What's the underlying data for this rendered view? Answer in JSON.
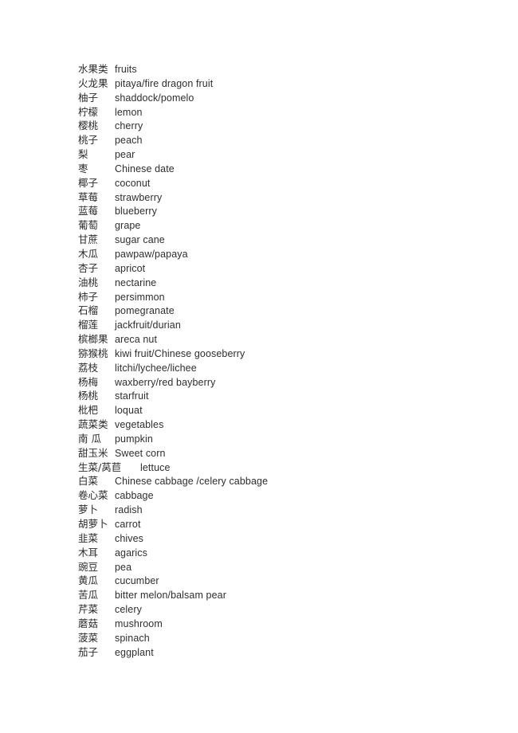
{
  "document": {
    "background_color": "#ffffff",
    "text_color": "#2e2e2e",
    "entries": [
      {
        "term": "水果类",
        "gloss": "fruits"
      },
      {
        "term": "火龙果",
        "gloss": "pitaya/fire dragon fruit"
      },
      {
        "term": "柚子",
        "gloss": "shaddock/pomelo"
      },
      {
        "term": "柠檬",
        "gloss": "lemon"
      },
      {
        "term": "樱桃",
        "gloss": "cherry"
      },
      {
        "term": "桃子",
        "gloss": "peach"
      },
      {
        "term": "梨",
        "gloss": "pear"
      },
      {
        "term": "枣",
        "gloss": "Chinese date"
      },
      {
        "term": "椰子",
        "gloss": "coconut"
      },
      {
        "term": "草莓",
        "gloss": "strawberry"
      },
      {
        "term": "蓝莓",
        "gloss": "blueberry"
      },
      {
        "term": "葡萄",
        "gloss": "grape"
      },
      {
        "term": "甘蔗",
        "gloss": "sugar cane"
      },
      {
        "term": "木瓜",
        "gloss": "pawpaw/papaya"
      },
      {
        "term": "杏子",
        "gloss": "apricot"
      },
      {
        "term": "油桃",
        "gloss": "nectarine"
      },
      {
        "term": "柿子",
        "gloss": "persimmon"
      },
      {
        "term": "石榴",
        "gloss": "pomegranate"
      },
      {
        "term": "榴莲",
        "gloss": "jackfruit/durian"
      },
      {
        "term": "槟榔果",
        "gloss": "areca nut"
      },
      {
        "term": "猕猴桃",
        "gloss": "kiwi fruit/Chinese gooseberry"
      },
      {
        "term": "荔枝",
        "gloss": "litchi/lychee/lichee"
      },
      {
        "term": "杨梅",
        "gloss": "waxberry/red bayberry"
      },
      {
        "term": "杨桃",
        "gloss": "starfruit"
      },
      {
        "term": "枇杷",
        "gloss": "loquat"
      },
      {
        "term": "蔬菜类",
        "gloss": "vegetables"
      },
      {
        "term": "南 瓜",
        "gloss": "pumpkin"
      },
      {
        "term": "甜玉米",
        "gloss": "Sweet corn"
      },
      {
        "term": "生菜/莴苣",
        "gloss": "lettuce",
        "wide": true
      },
      {
        "term": "白菜",
        "gloss": "Chinese cabbage /celery cabbage"
      },
      {
        "term": "卷心菜",
        "gloss": "cabbage"
      },
      {
        "term": "萝卜",
        "gloss": "radish"
      },
      {
        "term": "胡萝卜",
        "gloss": "carrot"
      },
      {
        "term": "韭菜",
        "gloss": "chives"
      },
      {
        "term": "木耳",
        "gloss": "agarics"
      },
      {
        "term": "豌豆",
        "gloss": "pea"
      },
      {
        "term": "黄瓜",
        "gloss": "cucumber"
      },
      {
        "term": "苦瓜",
        "gloss": "bitter melon/balsam pear"
      },
      {
        "term": "芹菜",
        "gloss": "celery"
      },
      {
        "term": "蘑菇",
        "gloss": "mushroom"
      },
      {
        "term": "菠菜",
        "gloss": "spinach"
      },
      {
        "term": "茄子",
        "gloss": "eggplant"
      }
    ]
  }
}
